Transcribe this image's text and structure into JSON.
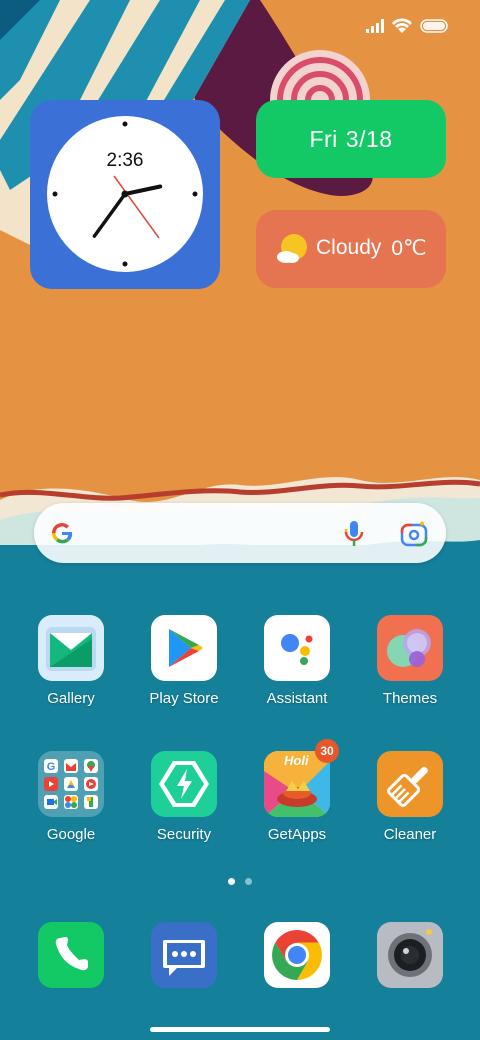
{
  "status_bar": {
    "signal_icon": "signal-icon",
    "wifi_icon": "wifi-icon",
    "battery_icon": "battery-icon"
  },
  "clock_widget": {
    "time": "2:36",
    "hour": 2,
    "minute": 36,
    "second": 26
  },
  "date_widget": {
    "weekday": "Fri",
    "date": "3/18"
  },
  "weather_widget": {
    "icon": "partly-cloudy-icon",
    "condition": "Cloudy",
    "temperature": "0℃"
  },
  "search_bar": {
    "logo": "google-g-icon",
    "mic": "mic-icon",
    "lens": "lens-icon"
  },
  "apps": [
    {
      "label": "Gallery",
      "icon": "gallery-icon"
    },
    {
      "label": "Play Store",
      "icon": "play-store-icon"
    },
    {
      "label": "Assistant",
      "icon": "assistant-icon"
    },
    {
      "label": "Themes",
      "icon": "themes-icon"
    },
    {
      "label": "Google",
      "icon": "google-folder-icon"
    },
    {
      "label": "Security",
      "icon": "security-icon"
    },
    {
      "label": "GetApps",
      "icon": "getapps-icon",
      "badge": "30",
      "banner": "Holi"
    },
    {
      "label": "Cleaner",
      "icon": "cleaner-icon"
    }
  ],
  "page_indicator": {
    "total": 2,
    "current": 1
  },
  "dock": [
    {
      "icon": "phone-icon"
    },
    {
      "icon": "messages-icon"
    },
    {
      "icon": "chrome-icon"
    },
    {
      "icon": "camera-icon"
    }
  ],
  "colors": {
    "wallpaper_orange": "#e59342",
    "wallpaper_teal": "#14809a",
    "clock_widget_bg": "#3b70d6",
    "date_widget_bg": "#12c965",
    "weather_widget_bg": "#e57450"
  }
}
